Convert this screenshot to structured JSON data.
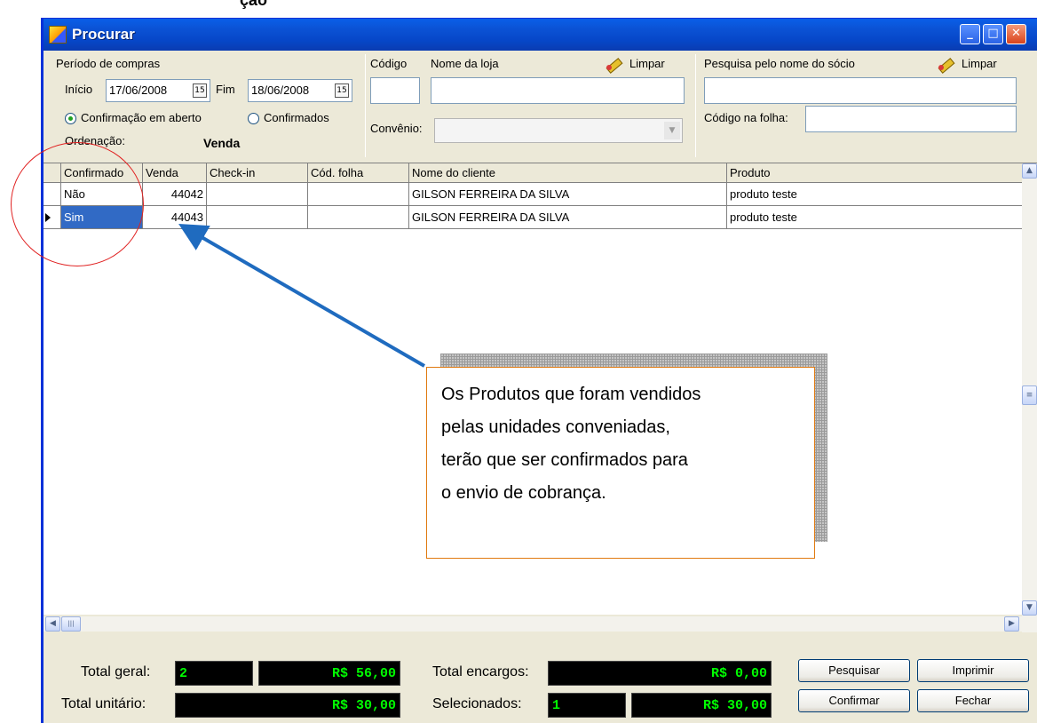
{
  "pre_text": "ção",
  "window": {
    "title": "Procurar",
    "min_symbol": "_",
    "max_symbol": "□",
    "close_symbol": "✕"
  },
  "filters": {
    "periodo_label": "Período de compras",
    "inicio_label": "Início",
    "inicio_value": "17/06/2008",
    "fim_label": "Fim",
    "fim_value": "18/06/2008",
    "calendar_day": "15",
    "radio_aberto": "Confirmação em aberto",
    "radio_confirmados": "Confirmados",
    "ordenacao_label": "Ordenação:",
    "ordenacao_value": "Venda",
    "codigo_label": "Código",
    "codigo_value": "",
    "nome_loja_label": "Nome da loja",
    "nome_loja_value": "",
    "limpar_label": "Limpar",
    "convenio_label": "Convênio:",
    "convenio_value": "",
    "dropdown_arrow": "▼",
    "socio_label": "Pesquisa pelo nome do sócio",
    "socio_value": "",
    "folha_label": "Código na folha:",
    "folha_value": ""
  },
  "table": {
    "columns": [
      "Confirmado",
      "Venda",
      "Check-in",
      "Cód. folha",
      "Nome do cliente",
      "Produto"
    ],
    "rows": [
      {
        "confirmado": "Não",
        "venda": "44042",
        "checkin": "",
        "cod_folha": "",
        "cliente": "GILSON FERREIRA DA SILVA",
        "produto": "produto teste"
      },
      {
        "confirmado": "Sim",
        "venda": "44043",
        "checkin": "",
        "cod_folha": "",
        "cliente": "GILSON FERREIRA DA SILVA",
        "produto": "produto teste"
      }
    ]
  },
  "scroll": {
    "up": "▲",
    "down": "▼",
    "left": "◀",
    "right": "▶",
    "grip": "≡",
    "hgrip": "|||"
  },
  "totals": {
    "total_geral_label": "Total geral:",
    "total_geral_count": "2",
    "total_geral_value": "R$ 56,00",
    "total_unitario_label": "Total unitário:",
    "total_unitario_count": "",
    "total_unitario_value": "R$ 30,00",
    "total_encargos_label": "Total encargos:",
    "total_encargos_count": "",
    "total_encargos_value": "R$ 0,00",
    "selecionados_label": "Selecionados:",
    "selecionados_count": "1",
    "selecionados_value": "R$ 30,00"
  },
  "buttons": {
    "pesquisar": "Pesquisar",
    "imprimir": "Imprimir",
    "confirmar": "Confirmar",
    "fechar": "Fechar"
  },
  "annotation": {
    "callout_text": "Os Produtos que foram vendidos\npelas unidades conveniadas,\nterão que ser confirmados para\no envio de cobrança.",
    "arrow_color": "#1f6bbf",
    "ellipse_color": "#e02020",
    "callout_border_color": "#e07a10"
  }
}
